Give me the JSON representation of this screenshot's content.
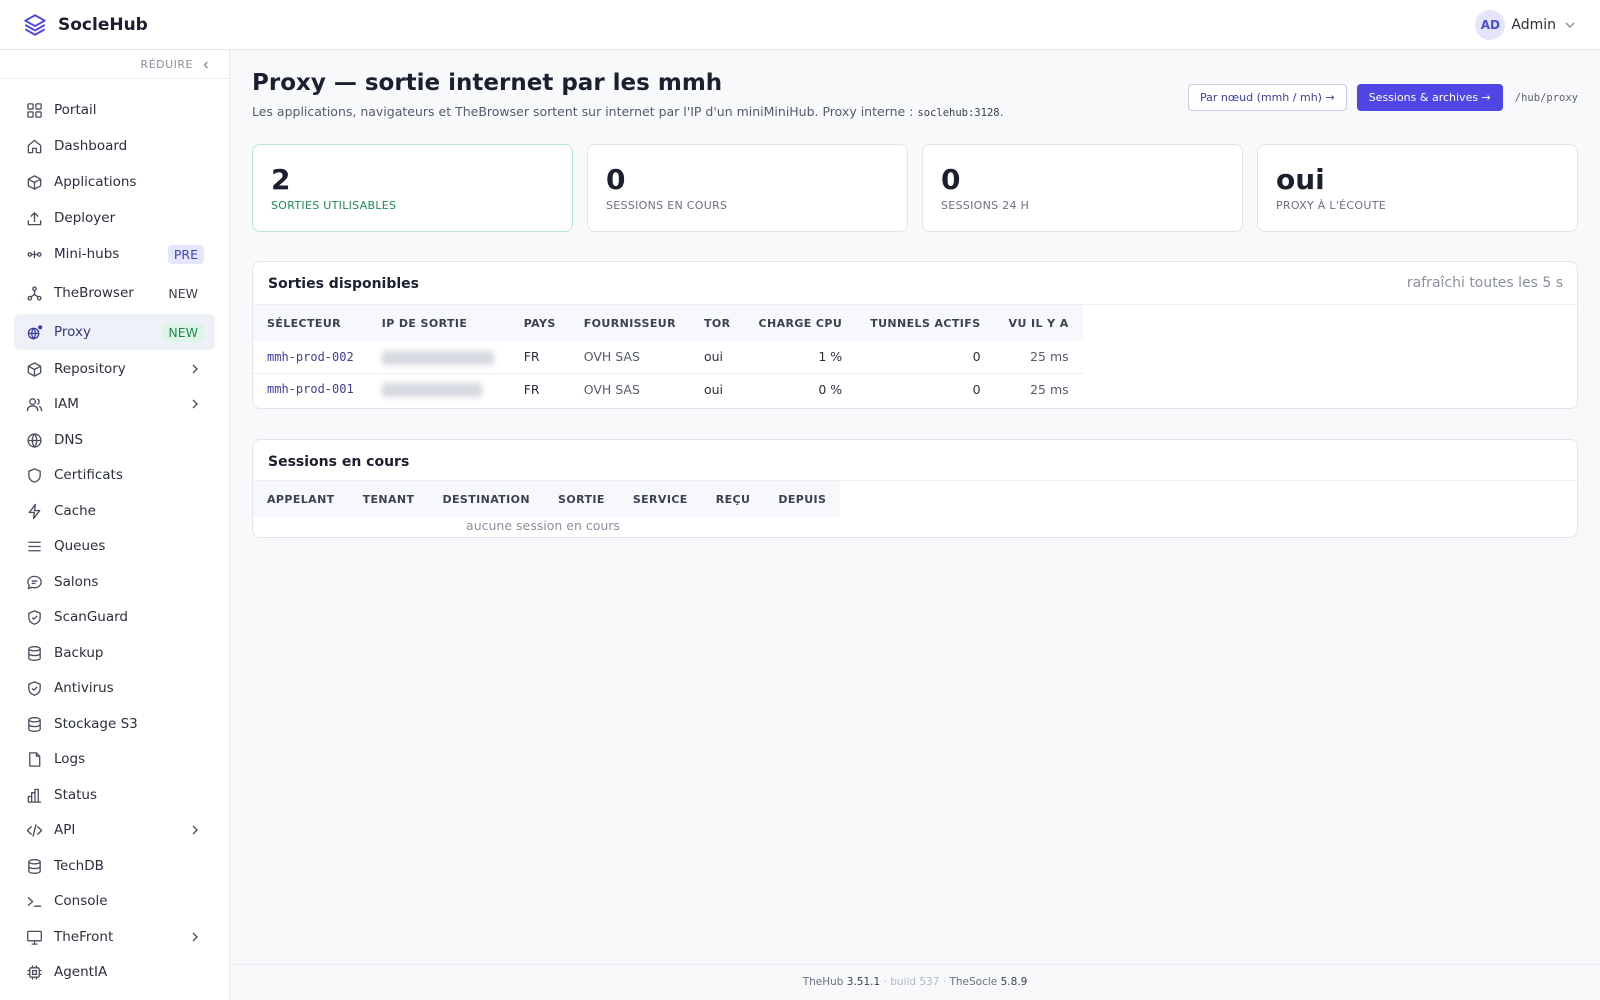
{
  "app": {
    "name": "SocleHub"
  },
  "user": {
    "initials": "AD",
    "name": "Admin"
  },
  "sidebar": {
    "collapse_label": "RÉDUIRE",
    "items": [
      {
        "label": "Portail"
      },
      {
        "label": "Dashboard"
      },
      {
        "label": "Applications"
      },
      {
        "label": "Deployer"
      },
      {
        "label": "Mini-hubs",
        "badge": "PRE"
      },
      {
        "label": "TheBrowser",
        "badge": "NEW"
      },
      {
        "label": "Proxy",
        "badge": "NEW"
      },
      {
        "label": "Repository"
      },
      {
        "label": "IAM"
      },
      {
        "label": "DNS"
      },
      {
        "label": "Certificats"
      },
      {
        "label": "Cache"
      },
      {
        "label": "Queues"
      },
      {
        "label": "Salons"
      },
      {
        "label": "ScanGuard"
      },
      {
        "label": "Backup"
      },
      {
        "label": "Antivirus"
      },
      {
        "label": "Stockage S3"
      },
      {
        "label": "Logs"
      },
      {
        "label": "Status"
      },
      {
        "label": "API"
      },
      {
        "label": "TechDB"
      },
      {
        "label": "Console"
      },
      {
        "label": "TheFront"
      },
      {
        "label": "AgentIA"
      }
    ]
  },
  "page": {
    "title": "Proxy — sortie internet par les mmh",
    "subtitle": "Les applications, navigateurs et TheBrowser sortent sur internet par l'IP d'un miniMiniHub. Proxy interne :",
    "proxy_address": "soclehub:3128",
    "subtitle_end": ".",
    "btn_per_node": "Par nœud (mmh / mh) →",
    "btn_sessions": "Sessions & archives →",
    "route": "/hub/proxy"
  },
  "stats": [
    {
      "value": "2",
      "label": "SORTIES UTILISABLES"
    },
    {
      "value": "0",
      "label": "SESSIONS EN COURS"
    },
    {
      "value": "0",
      "label": "SESSIONS 24 H"
    },
    {
      "value": "oui",
      "label": "PROXY À L'ÉCOUTE"
    }
  ],
  "exits": {
    "title": "Sorties disponibles",
    "refresh_note": "rafraîchi toutes les 5 s",
    "columns": [
      "SÉLECTEUR",
      "IP DE SORTIE",
      "PAYS",
      "FOURNISSEUR",
      "TOR",
      "CHARGE CPU",
      "TUNNELS ACTIFS",
      "VU IL Y A"
    ],
    "rows": [
      {
        "selector": "mmh-prod-002",
        "country": "FR",
        "provider": "OVH SAS",
        "tor": "oui",
        "cpu": "1 %",
        "tunnels": "0",
        "seen": "25 ms"
      },
      {
        "selector": "mmh-prod-001",
        "country": "FR",
        "provider": "OVH SAS",
        "tor": "oui",
        "cpu": "0 %",
        "tunnels": "0",
        "seen": "25 ms"
      }
    ]
  },
  "sessions": {
    "title": "Sessions en cours",
    "columns": [
      "APPELANT",
      "TENANT",
      "DESTINATION",
      "SORTIE",
      "SERVICE",
      "REÇU",
      "DEPUIS"
    ],
    "empty": "aucune session en cours"
  },
  "footer": {
    "thehub_label": "TheHub",
    "thehub_version": "3.51.1",
    "build": "build 537",
    "thesocle_label": "TheSocle",
    "thesocle_version": "5.8.9"
  },
  "colors": {
    "accent": "#4f46e5",
    "active_bg": "#eef1f8",
    "success": "#1e8a51"
  }
}
